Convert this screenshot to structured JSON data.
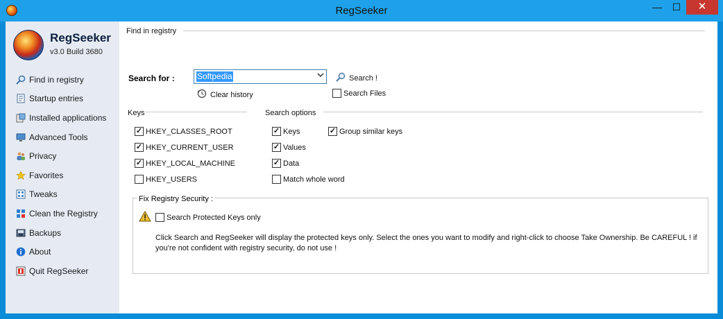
{
  "window": {
    "title": "RegSeeker",
    "controls": {
      "minimize": "—",
      "maximize": "☐",
      "close": "✕"
    }
  },
  "sidebar": {
    "app_name": "RegSeeker",
    "version": "v3.0 Build 3680",
    "items": [
      {
        "label": "Find in registry",
        "icon": "magnifier-icon"
      },
      {
        "label": "Startup entries",
        "icon": "document-icon"
      },
      {
        "label": "Installed applications",
        "icon": "applications-icon"
      },
      {
        "label": "Advanced Tools",
        "icon": "monitor-icon"
      },
      {
        "label": "Privacy",
        "icon": "users-icon"
      },
      {
        "label": "Favorites",
        "icon": "star-icon"
      },
      {
        "label": "Tweaks",
        "icon": "tweaks-icon"
      },
      {
        "label": "Clean the Registry",
        "icon": "registry-icon"
      },
      {
        "label": "Backups",
        "icon": "backup-icon"
      },
      {
        "label": "About",
        "icon": "info-icon"
      },
      {
        "label": "Quit RegSeeker",
        "icon": "quit-icon"
      }
    ]
  },
  "main": {
    "section_title": "Find in registry",
    "search_label": "Search for :",
    "search_value": "Softpedia",
    "search_button": "Search !",
    "clear_history": "Clear history",
    "search_files": "Search Files",
    "keys_title": "Keys",
    "keys": [
      {
        "label": "HKEY_CLASSES_ROOT",
        "checked": true
      },
      {
        "label": "HKEY_CURRENT_USER",
        "checked": true
      },
      {
        "label": "HKEY_LOCAL_MACHINE",
        "checked": true
      },
      {
        "label": "HKEY_USERS",
        "checked": false
      }
    ],
    "options_title": "Search options",
    "options": [
      {
        "label": "Keys",
        "checked": true
      },
      {
        "label": "Values",
        "checked": true
      },
      {
        "label": "Data",
        "checked": true
      },
      {
        "label": "Match whole word",
        "checked": false
      }
    ],
    "group_similar": {
      "label": "Group similar keys",
      "checked": true
    },
    "fix_security": {
      "title": "Fix Registry Security :",
      "checkbox": "Search Protected Keys only",
      "text": "Click Search and RegSeeker will display the protected keys only. Select the ones you want to modify and right-click to choose Take Ownership. Be CAREFUL ! if you're not confident with registry security, do not use !"
    }
  },
  "colors": {
    "titlebar": "#1ea1e8",
    "close": "#c7372f",
    "sidebar": "#e6ebf3",
    "selection": "#3399ff"
  }
}
